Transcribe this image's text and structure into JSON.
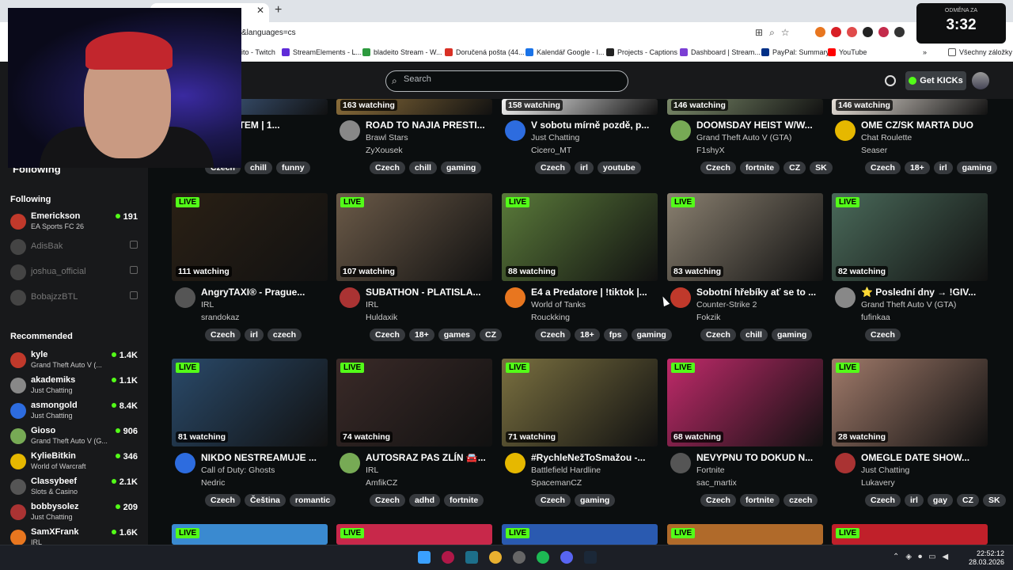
{
  "browser": {
    "url": "&languages=cs",
    "bookmarks": [
      "ito - Twitch",
      "StreamElements - L...",
      "bladeito Stream - W...",
      "Doručená pošta (44...",
      "Kalendář Google - I...",
      "Projects - Captions",
      "Dashboard | Stream...",
      "PayPal: Summary",
      "YouTube",
      "Všechny záložky"
    ]
  },
  "timer": {
    "label": "ODMĚNA ZA",
    "value": "3:32"
  },
  "header": {
    "search_placeholder": "Search",
    "get_kicks": "Get KICKs"
  },
  "sidebar": {
    "following_tab": "Following",
    "following_title": "Following",
    "following": [
      {
        "name": "Emerickson",
        "category": "EA Sports FC 26",
        "viewers": "191",
        "live": true
      },
      {
        "name": "AdisBak",
        "live": false
      },
      {
        "name": "joshua_official",
        "live": false
      },
      {
        "name": "BobajzzBTL",
        "live": false
      }
    ],
    "recommended_title": "Recommended",
    "recommended": [
      {
        "name": "kyle",
        "category": "Grand Theft Auto V (...",
        "viewers": "1.4K"
      },
      {
        "name": "akademiks",
        "category": "Just Chatting",
        "viewers": "1.1K"
      },
      {
        "name": "asmongold",
        "category": "Just Chatting",
        "viewers": "8.4K"
      },
      {
        "name": "Gioso",
        "category": "Grand Theft Auto V (G...",
        "viewers": "906"
      },
      {
        "name": "KylieBitkin",
        "category": "World of Warcraft",
        "viewers": "346"
      },
      {
        "name": "Classybeef",
        "category": "Slots & Casino",
        "viewers": "2.1K"
      },
      {
        "name": "bobbysolez",
        "category": "Just Chatting",
        "viewers": "209"
      },
      {
        "name": "SamXFrank",
        "category": "IRL",
        "viewers": "1.6K"
      }
    ]
  },
  "live_label": "LIVE",
  "rows": [
    [
      {
        "watching": "",
        "title": "Y S CHATEM | 1...",
        "category": "",
        "streamer": "K",
        "tags": [
          "Czech",
          "chill",
          "funny"
        ]
      },
      {
        "watching": "163 watching",
        "title": "ROAD TO NAJIA PRESTI...",
        "category": "Brawl Stars",
        "streamer": "ZyXousek",
        "tags": [
          "Czech",
          "chill",
          "gaming"
        ]
      },
      {
        "watching": "158 watching",
        "title": "V sobotu mírně pozdě, p...",
        "category": "Just Chatting",
        "streamer": "Cicero_MT",
        "tags": [
          "Czech",
          "irl",
          "youtube"
        ]
      },
      {
        "watching": "146 watching",
        "title": "DOOMSDAY HEIST W/W...",
        "category": "Grand Theft Auto V (GTA)",
        "streamer": "F1shyX",
        "tags": [
          "Czech",
          "fortnite",
          "CZ",
          "SK"
        ]
      },
      {
        "watching": "146 watching",
        "title": "OME CZ/SK MARTA DUO",
        "category": "Chat Roulette",
        "streamer": "Seaser",
        "tags": [
          "Czech",
          "18+",
          "irl",
          "gaming"
        ]
      }
    ],
    [
      {
        "watching": "111 watching",
        "title": "AngryTAXI® - Prague...",
        "category": "IRL",
        "streamer": "srandokaz",
        "tags": [
          "Czech",
          "irl",
          "czech"
        ]
      },
      {
        "watching": "107 watching",
        "title": "SUBATHON - PLATISLA...",
        "category": "IRL",
        "streamer": "Huldaxik",
        "tags": [
          "Czech",
          "18+",
          "games",
          "CZ"
        ]
      },
      {
        "watching": "88 watching",
        "title": "E4 a Predatore | !tiktok |...",
        "category": "World of Tanks",
        "streamer": "Rouckking",
        "tags": [
          "Czech",
          "18+",
          "fps",
          "gaming"
        ]
      },
      {
        "watching": "83 watching",
        "title": "Sobotní hřebíky ať se to ...",
        "category": "Counter-Strike 2",
        "streamer": "Fokzik",
        "tags": [
          "Czech",
          "chill",
          "gaming"
        ]
      },
      {
        "watching": "82 watching",
        "title": "⭐ Poslední dny → !GIV...",
        "category": "Grand Theft Auto V (GTA)",
        "streamer": "fufinkaa",
        "tags": [
          "Czech"
        ]
      }
    ],
    [
      {
        "watching": "81 watching",
        "title": "NIKDO NESTREAMUJE ...",
        "category": "Call of Duty: Ghosts",
        "streamer": "Nedric",
        "tags": [
          "Czech",
          "Čeština",
          "romantic"
        ]
      },
      {
        "watching": "74 watching",
        "title": "AUTOSRAZ PAS ZLÍN 🚘...",
        "category": "IRL",
        "streamer": "AmfikCZ",
        "tags": [
          "Czech",
          "adhd",
          "fortnite"
        ]
      },
      {
        "watching": "71 watching",
        "title": "#RychleNežToSmažou -...",
        "category": "Battlefield Hardline",
        "streamer": "SpacemanCZ",
        "tags": [
          "Czech",
          "gaming"
        ]
      },
      {
        "watching": "68 watching",
        "title": "NEVYPNU TO DOKUD N...",
        "category": "Fortnite",
        "streamer": "sac_martix",
        "tags": [
          "Czech",
          "fortnite",
          "czech"
        ]
      },
      {
        "watching": "28 watching",
        "title": "OMEGLE DATE SHOW...",
        "category": "Just Chatting",
        "streamer": "Lukavery",
        "tags": [
          "Czech",
          "irl",
          "gay",
          "CZ",
          "SK"
        ]
      }
    ]
  ],
  "taskbar": {
    "time": "22:52:12",
    "date": "28.03.2026"
  },
  "colors": {
    "accent": "#53fc18",
    "background": "#0b0e0f",
    "sidebar": "#18191b",
    "tag": "#36393d"
  }
}
